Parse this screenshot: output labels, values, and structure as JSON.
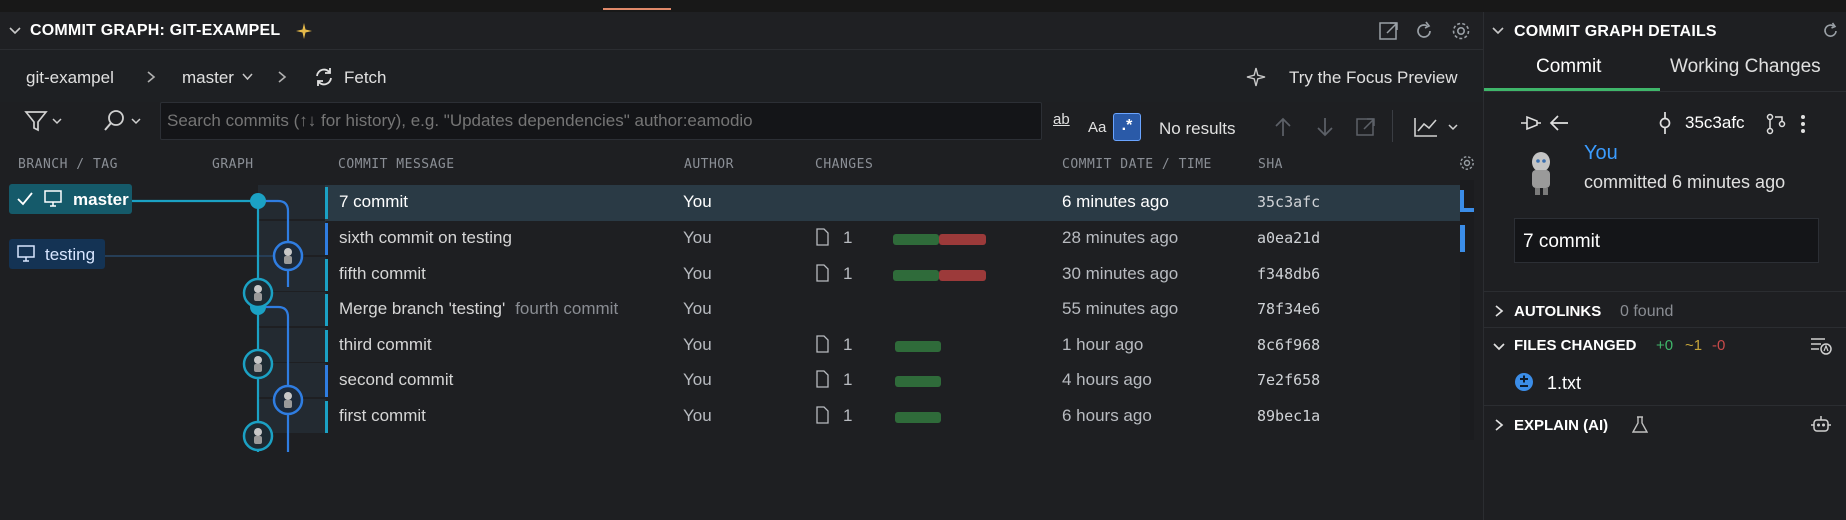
{
  "panel": {
    "title": "COMMIT GRAPH: GIT-EXAMPEL"
  },
  "breadcrumb": {
    "repo": "git-exampel",
    "branch": "master",
    "fetch": "Fetch",
    "focus_preview": "Try the Focus Preview"
  },
  "search": {
    "placeholder": "Search commits (↑↓ for history), e.g. \"Updates dependencies\" author:eamodio",
    "results": "No results",
    "opt_regex_label": "ab",
    "opt_case_label": "Aa",
    "opt_wildcard_label": ".*"
  },
  "columns": {
    "branch": "BRANCH / TAG",
    "graph": "GRAPH",
    "message": "COMMIT MESSAGE",
    "author": "AUTHOR",
    "changes": "CHANGES",
    "date": "COMMIT DATE / TIME",
    "sha": "SHA"
  },
  "refs": [
    {
      "name": "master",
      "checked": true
    },
    {
      "name": "testing",
      "checked": false
    }
  ],
  "commits": [
    {
      "message": "7 commit",
      "sub": "",
      "author": "You",
      "files": "",
      "added": 0,
      "deleted": 0,
      "date": "6 minutes ago",
      "sha": "35c3afc",
      "selected": true
    },
    {
      "message": "sixth commit on testing",
      "sub": "",
      "author": "You",
      "files": "1",
      "added": 1,
      "deleted": 1,
      "date": "28 minutes ago",
      "sha": "a0ea21d",
      "selected": false
    },
    {
      "message": "fifth commit",
      "sub": "",
      "author": "You",
      "files": "1",
      "added": 1,
      "deleted": 1,
      "date": "30 minutes ago",
      "sha": "f348db6",
      "selected": false
    },
    {
      "message": "Merge branch 'testing'",
      "sub": "fourth commit",
      "author": "You",
      "files": "",
      "added": 0,
      "deleted": 0,
      "date": "55 minutes ago",
      "sha": "78f34e6",
      "selected": false
    },
    {
      "message": "third commit",
      "sub": "",
      "author": "You",
      "files": "1",
      "added": 1,
      "deleted": 0,
      "date": "1 hour ago",
      "sha": "8c6f968",
      "selected": false
    },
    {
      "message": "second commit",
      "sub": "",
      "author": "You",
      "files": "1",
      "added": 1,
      "deleted": 0,
      "date": "4 hours ago",
      "sha": "7e2f658",
      "selected": false
    },
    {
      "message": "first commit",
      "sub": "",
      "author": "You",
      "files": "1",
      "added": 1,
      "deleted": 0,
      "date": "6 hours ago",
      "sha": "89bec1a",
      "selected": false
    }
  ],
  "details": {
    "title": "COMMIT GRAPH DETAILS",
    "tab_commit": "Commit",
    "tab_working": "Working Changes",
    "sha": "35c3afc",
    "author": "You",
    "committed": "committed 6 minutes ago",
    "message": "7 commit",
    "autolinks_label": "AUTOLINKS",
    "autolinks_found": "0 found",
    "files_changed_label": "FILES CHANGED",
    "added": "+0",
    "modified": "~1",
    "deleted": "-0",
    "file_name": "1.txt",
    "explain_label": "EXPLAIN (AI)"
  },
  "colors": {
    "branch_master": "#1ba1c4",
    "branch_testing": "#2f7de1",
    "added_bar": "#2f6b3a",
    "deleted_bar": "#9c3a3a",
    "selected_row": "#2a3a45",
    "accent_tab": "#3fb66a"
  }
}
